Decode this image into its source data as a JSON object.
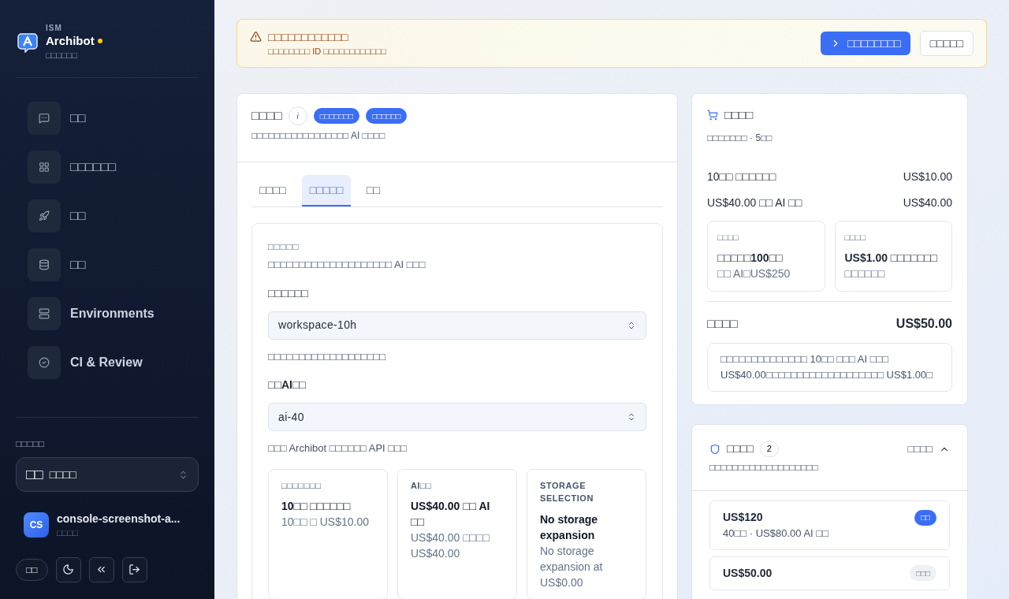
{
  "sidebar": {
    "brand": {
      "org": "ISM",
      "name": "Archibot",
      "subtitle": "□□□□□□"
    },
    "items": [
      {
        "label": "□□"
      },
      {
        "label": "□□□□□□"
      },
      {
        "label": "□□"
      },
      {
        "label": "□□"
      },
      {
        "label": "Environments"
      },
      {
        "label": "CI & Review"
      }
    ],
    "workspace": {
      "label": "□□□□□",
      "flag": "□□",
      "value": "□□□□"
    },
    "user": {
      "initials": "CS",
      "name": "console-screenshot-a...",
      "role": "□□□□"
    },
    "language": "□□"
  },
  "banner": {
    "title": "□□□□□□□□□□□□",
    "text": "□□□□□□□□ ID □□□□□□□□□□□□",
    "primary": "□□□□□□□□",
    "secondary": "□□□□□"
  },
  "plan": {
    "title": "□□□□",
    "info": "i",
    "badges": [
      "□□□□□□□",
      "□□□□□□"
    ],
    "description": "□□□□□□□□□□□□□□□□□ AI □□□□",
    "tabs": [
      {
        "label": "□□□□",
        "selected": false
      },
      {
        "label": "□□□□□",
        "selected": true
      },
      {
        "label": "□□",
        "selected": false
      }
    ],
    "section": {
      "title": "□□□□□",
      "description": "□□□□□□□□□□□□□□□□□□□□ AI □□□",
      "fields": [
        {
          "label": "□□□□□□",
          "value": "workspace-10h",
          "help": "□□□□□□□□□□□□□□□□□□□"
        },
        {
          "label": "□□AI□□",
          "value": "ai-40",
          "help": "□□□ Archibot □□□□□□ API □□□"
        }
      ],
      "options": [
        {
          "title": "□□□□□□□",
          "name": "10□□ □□□□□□",
          "detail": "10□□ □ US$10.00"
        },
        {
          "title": "AI□□",
          "name": "US$40.00 □□ AI □□",
          "detail": "US$40.00 □□□□ US$40.00"
        },
        {
          "title": "STORAGE SELECTION",
          "name": "No storage expansion",
          "detail": "No storage expansion at US$0.00"
        }
      ]
    }
  },
  "summary": {
    "title": "□□□□",
    "subtitle": "□□□□□□□ · 5□□",
    "lines": [
      {
        "label": "10□□ □□□□□□",
        "amount": "US$10.00"
      },
      {
        "label": "US$40.00 □□ AI □□",
        "amount": "US$40.00"
      }
    ],
    "boxes": [
      {
        "title": "□□□□",
        "main": "□□□□□100□□",
        "sub": "□□ AI□US$250"
      },
      {
        "title": "□□□□",
        "main": "US$1.00 □□□□□□□",
        "sub": "□□□□□□"
      }
    ],
    "total_label": "□□□□",
    "total": "US$50.00",
    "note": "□□□□□□□□□□□□□□ 10□□ □□□ AI □□□ US$40.00□□□□□□□□□□□□□□□□□□□ US$1.00□"
  },
  "recommend": {
    "title": "□□□□",
    "count": "2",
    "toggle": "□□□□",
    "expanded": true,
    "description": "□□□□□□□□□□□□□□□□□□□",
    "items": [
      {
        "price": "US$120",
        "badge": "□□",
        "kind": "primary",
        "detail": "40□□ · US$80.00 AI □□"
      },
      {
        "price": "US$50.00",
        "badge": "□□□",
        "kind": "muted"
      }
    ]
  }
}
